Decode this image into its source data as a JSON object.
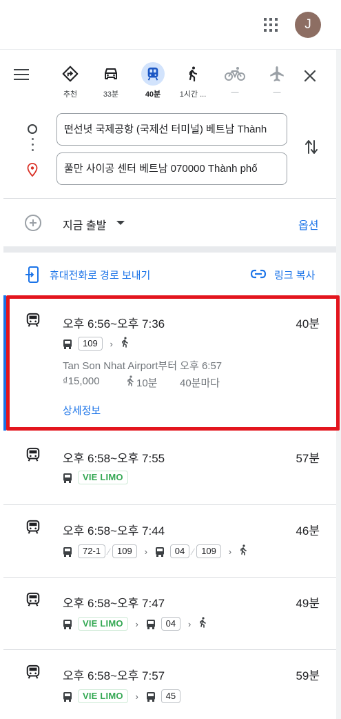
{
  "header": {
    "avatar_letter": "J"
  },
  "modes": [
    {
      "name": "best",
      "label": "추천"
    },
    {
      "name": "drive",
      "label": "33분"
    },
    {
      "name": "transit",
      "label": "40분"
    },
    {
      "name": "walk",
      "label": "1시간 ..."
    },
    {
      "name": "bike",
      "label": "—"
    },
    {
      "name": "flight",
      "label": "—"
    }
  ],
  "origin": {
    "value": "떤선녓 국제공항 (국제선 터미널) 베트남 Thành"
  },
  "destination": {
    "value": "풀만 사이공 센터 베트남 070000 Thành phố"
  },
  "depart": {
    "label": "지금 출발",
    "options": "옵션"
  },
  "share": {
    "send_to_phone": "휴대전화로 경로 보내기",
    "copy_link": "링크 복사"
  },
  "routes": [
    {
      "time": "오후 6:56~오후 7:36",
      "duration": "40분",
      "steps": {
        "bus": "109"
      },
      "from": "Tan Son Nhat Airport부터 오후 6:57",
      "fare": "₫15,000",
      "walk": "10분",
      "frequency": "40분마다",
      "details": "상세정보"
    },
    {
      "time": "오후 6:58~오후 7:55",
      "duration": "57분",
      "steps": {
        "chip": "VIE LIMO"
      }
    },
    {
      "time": "오후 6:58~오후 7:44",
      "duration": "46분",
      "steps": {
        "a1": "72-1",
        "a2": "109",
        "b1": "04",
        "b2": "109"
      }
    },
    {
      "time": "오후 6:58~오후 7:47",
      "duration": "49분",
      "steps": {
        "chip": "VIE LIMO",
        "bus": "04"
      }
    },
    {
      "time": "오후 6:58~오후 7:57",
      "duration": "59분",
      "steps": {
        "chip": "VIE LIMO",
        "bus": "45"
      }
    }
  ]
}
